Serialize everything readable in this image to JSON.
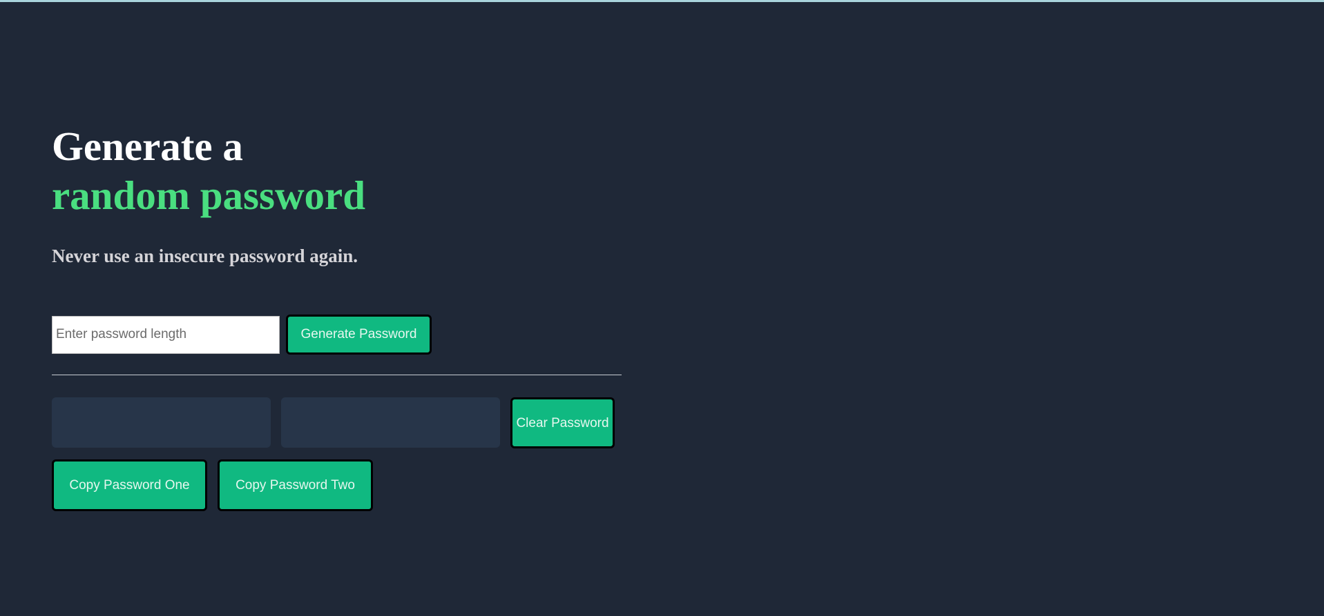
{
  "header": {
    "title_line1": "Generate a",
    "title_line2": "random password",
    "subtitle": "Never use an insecure password again."
  },
  "controls": {
    "length_placeholder": "Enter password length",
    "length_value": "",
    "generate_label": "Generate Password"
  },
  "output": {
    "password_one": "",
    "password_two": "",
    "clear_label": "Clear Password"
  },
  "copy": {
    "copy_one_label": "Copy Password One",
    "copy_two_label": "Copy Password Two"
  },
  "colors": {
    "background": "#1f2837",
    "accent": "#4ade80",
    "button": "#10b981",
    "output_box": "#273549"
  }
}
